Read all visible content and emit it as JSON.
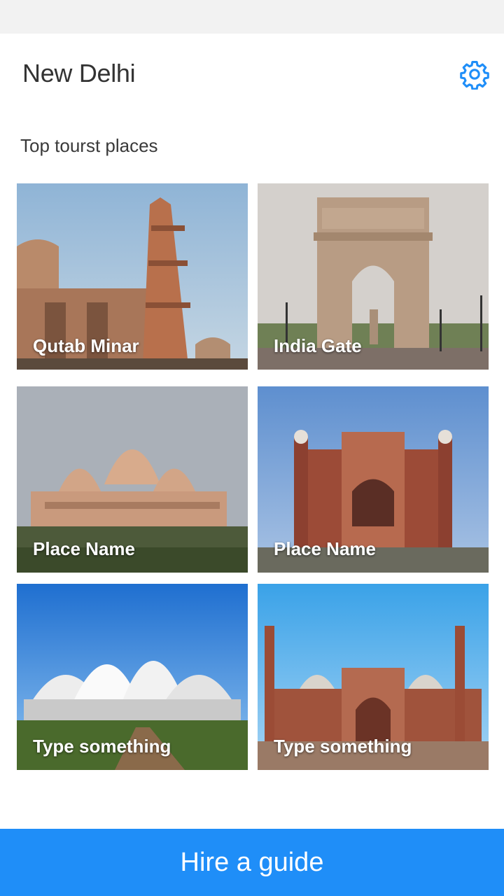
{
  "header": {
    "city": "New Delhi",
    "settings_icon": "gear-icon"
  },
  "section": {
    "title": "Top tourst places"
  },
  "places": [
    {
      "label": "Qutab Minar"
    },
    {
      "label": "India Gate"
    },
    {
      "label": "Place Name"
    },
    {
      "label": "Place Name"
    },
    {
      "label": "Type something"
    },
    {
      "label": "Type something"
    }
  ],
  "footer": {
    "hire_label": "Hire a guide"
  },
  "colors": {
    "accent": "#1f8ef8",
    "status_bar": "#f2f2f2"
  }
}
